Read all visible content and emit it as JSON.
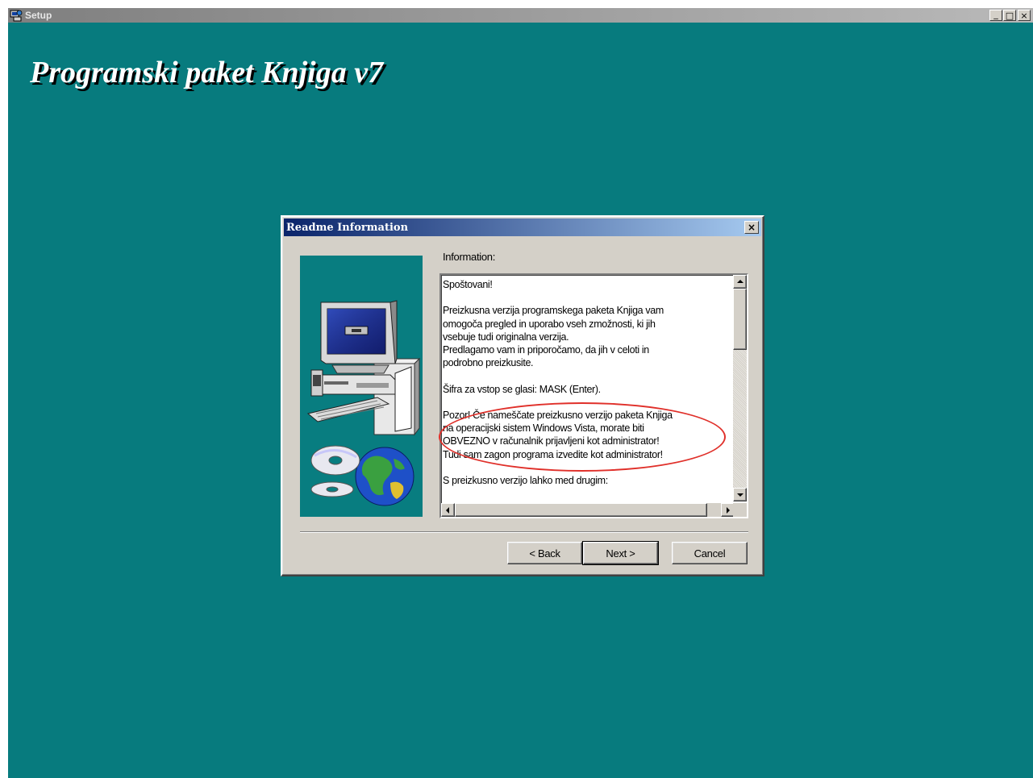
{
  "window": {
    "title": "Setup",
    "controls": {
      "minimize": "_",
      "maximize": "□",
      "close": "×"
    }
  },
  "banner": {
    "title": "Programski paket Knjiga v7"
  },
  "dialog": {
    "title": "Readme Information",
    "close_label": "×",
    "info_label": "Information:",
    "text_lines": [
      "Spoštovani!",
      "",
      "Preizkusna verzija programskega paketa Knjiga vam",
      "omogoča pregled in uporabo vseh zmožnosti, ki jih",
      "vsebuje tudi originalna verzija.",
      "Predlagamo vam in priporočamo, da jih v celoti in",
      "podrobno preizkusite.",
      "",
      "Šifra za vstop se glasi:  MASK   (Enter).",
      "",
      "Pozor! Če nameščate preizkusno verzijo paketa Knjiga",
      "na operacijski sistem Windows Vista, morate biti",
      "OBVEZNO v računalnik prijavljeni kot administrator!",
      "Tudi sam zagon programa izvedite kot administrator!",
      "",
      "S preizkusno verzijo lahko med drugim:"
    ],
    "buttons": {
      "back": "< Back",
      "next": "Next >",
      "cancel": "Cancel"
    },
    "highlight_color": "#e0302a"
  },
  "colors": {
    "desktop": "#077b7e",
    "dialog_face": "#d4d0c8",
    "dialog_title_start": "#0a246a",
    "dialog_title_end": "#a6caf0"
  },
  "icons": [
    "setup-app-icon",
    "computer-illustration",
    "cd-icon",
    "globe-icon"
  ]
}
